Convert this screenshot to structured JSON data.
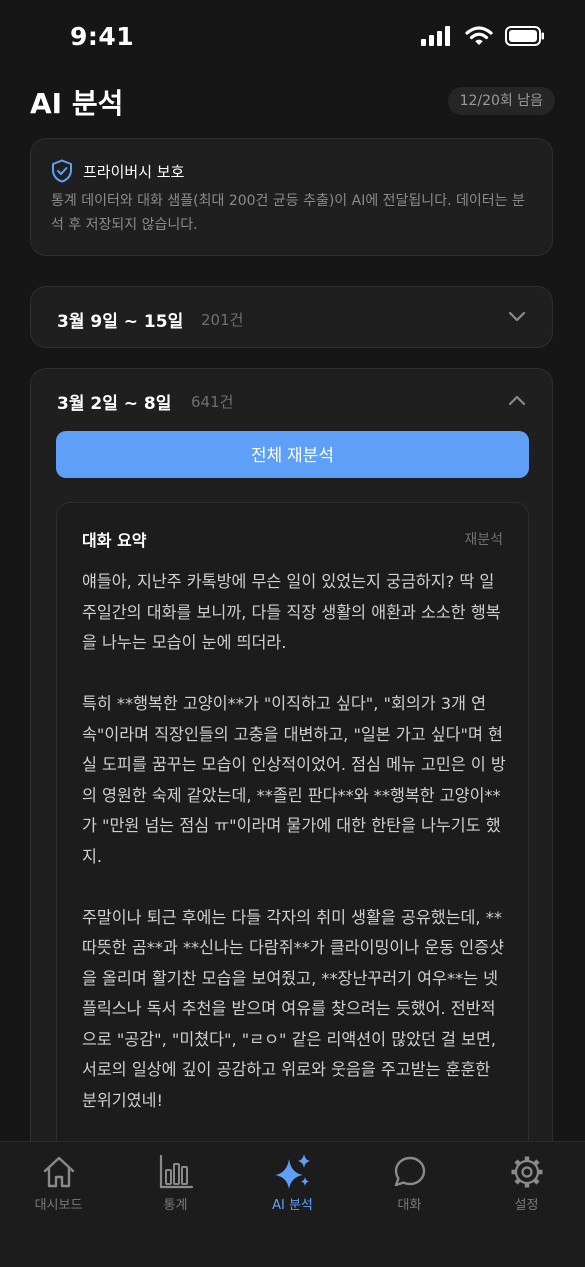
{
  "status_bar": {
    "time": "9:41"
  },
  "header": {
    "title": "AI 분석",
    "quota": "12/20회 남음"
  },
  "privacy": {
    "title": "프라이버시 보호",
    "text": "통계 데이터와 대화 샘플(최대 200건 균등 추출)이 AI에 전달됩니다. 데이터는 분석 후 저장되지 않습니다."
  },
  "weeks": [
    {
      "range": "3월 9일 ~ 15일",
      "count": "201건"
    },
    {
      "range": "3월 2일 ~ 8일",
      "count": "641건"
    }
  ],
  "reanalyze_all": "전체 재분석",
  "summary": {
    "title": "대화 요약",
    "reanalyze": "재분석",
    "paragraphs": [
      "얘들아, 지난주 카톡방에 무슨 일이 있었는지 궁금하지? 딱 일주일간의 대화를 보니까, 다들 직장 생활의 애환과 소소한 행복을 나누는 모습이 눈에 띄더라.",
      "특히 **행복한 고양이**가 \"이직하고 싶다\", \"회의가 3개 연속\"이라며 직장인들의 고충을 대변하고, \"일본 가고 싶다\"며 현실 도피를 꿈꾸는 모습이 인상적이었어. 점심 메뉴 고민은 이 방의 영원한 숙제 같았는데, **졸린 판다**와 **행복한 고양이**가 \"만원 넘는 점심 ㅠ\"이라며 물가에 대한 한탄을 나누기도 했지.",
      "주말이나 퇴근 후에는 다들 각자의 취미 생활을 공유했는데, **따뜻한 곰**과 **신나는 다람쥐**가 클라이밍이나 운동 인증샷을 올리며 활기찬 모습을 보여줬고, **장난꾸러기 여우**는 넷플릭스나 독서 추천을 받으며 여유를 찾으려는 듯했어. 전반적으로 \"공감\", \"미쳤다\", \"ㄹㅇ\" 같은 리액션이 많았던 걸 보면, 서로의 일상에 깊이 공감하고 위로와 웃음을 주고받는 훈훈한 분위기였네!"
    ]
  },
  "tabs": [
    {
      "label": "대시보드",
      "icon": "home-icon"
    },
    {
      "label": "통계",
      "icon": "bar-chart-icon"
    },
    {
      "label": "AI 분석",
      "icon": "sparkles-icon",
      "active": true
    },
    {
      "label": "대화",
      "icon": "chat-bubble-icon"
    },
    {
      "label": "설정",
      "icon": "gear-icon"
    }
  ],
  "colors": {
    "accent": "#5ea0f7",
    "background": "#161616",
    "card": "#1f1f1f"
  }
}
